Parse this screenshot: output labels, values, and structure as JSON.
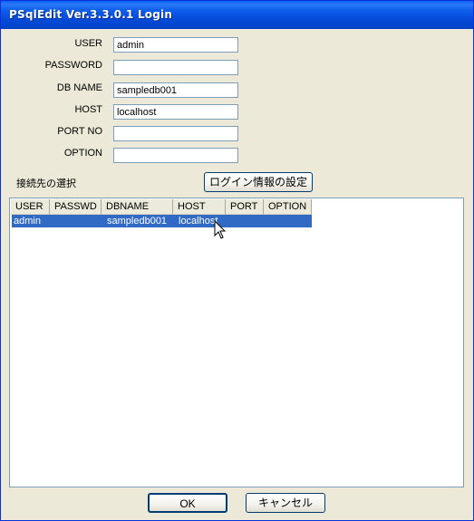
{
  "window": {
    "title": "PSqlEdit Ver.3.3.0.1 Login"
  },
  "form": {
    "user_label": "USER",
    "user_value": "admin",
    "password_label": "PASSWORD",
    "password_value": "",
    "dbname_label": "DB NAME",
    "dbname_value": "sampledb001",
    "host_label": "HOST",
    "host_value": "localhost",
    "port_label": "PORT NO",
    "port_value": "",
    "option_label": "OPTION",
    "option_value": ""
  },
  "connections": {
    "label": "接続先の選択",
    "settings_button": "ログイン情報の設定",
    "columns": [
      "USER",
      "PASSWD",
      "DBNAME",
      "HOST",
      "PORT",
      "OPTION"
    ],
    "rows": [
      {
        "user": "admin",
        "passwd": "",
        "dbname": "sampledb001",
        "host": "localhost",
        "port": "",
        "option": "",
        "selected": true
      }
    ]
  },
  "buttons": {
    "ok": "OK",
    "cancel": "キャンセル"
  },
  "colors": {
    "titlebar": "#0a5ff5",
    "selection": "#316ac5",
    "dialog_bg": "#ece9d8"
  }
}
